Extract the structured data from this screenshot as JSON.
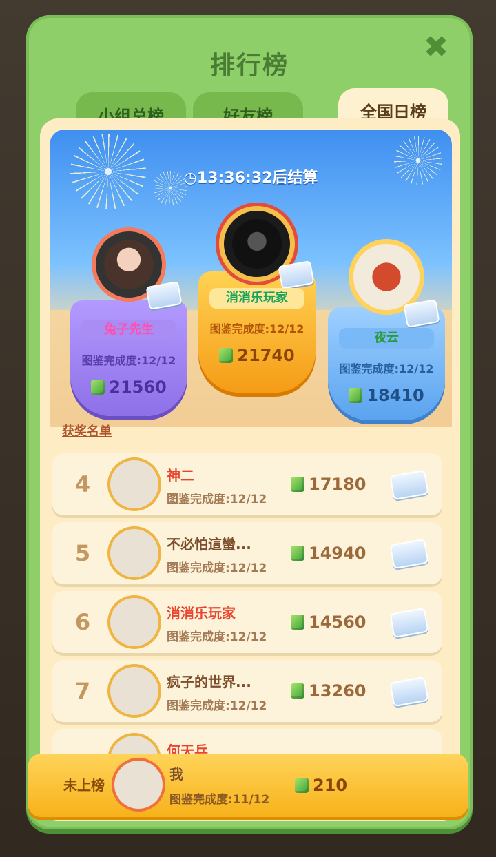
{
  "title": "排行榜",
  "close": "✖",
  "tabs": [
    "小组总榜",
    "好友榜",
    "全国日榜"
  ],
  "active_tab": "全国日榜",
  "timer": "◷13:36:32后结算",
  "top3": [
    {
      "rank": 2,
      "name": "兔子先生",
      "dex": "图鉴完成度:12/12",
      "score": "21560"
    },
    {
      "rank": 1,
      "name": "消消乐玩家",
      "dex": "图鉴完成度:12/12",
      "score": "21740"
    },
    {
      "rank": 3,
      "name": "夜云",
      "dex": "图鉴完成度:12/12",
      "score": "18410"
    }
  ],
  "winners_label": "获奖名单",
  "rows": [
    {
      "rank": "4",
      "name": "神二",
      "dex": "图鉴完成度:12/12",
      "score": "17180"
    },
    {
      "rank": "5",
      "name": "不必怕這蠻...",
      "dex": "图鉴完成度:12/12",
      "score": "14940"
    },
    {
      "rank": "6",
      "name": "消消乐玩家",
      "dex": "图鉴完成度:12/12",
      "score": "14560"
    },
    {
      "rank": "7",
      "name": "疯子的世界...",
      "dex": "图鉴完成度:12/12",
      "score": "13260"
    },
    {
      "rank": "",
      "name": "何天兵",
      "dex": "",
      "score": ""
    }
  ],
  "me": {
    "status": "未上榜",
    "name": "我",
    "dex": "图鉴完成度:11/12",
    "score": "210"
  },
  "colors": {
    "panel": "#8fcf6a",
    "content": "#fdecc4",
    "gold": "#f7b21a"
  }
}
